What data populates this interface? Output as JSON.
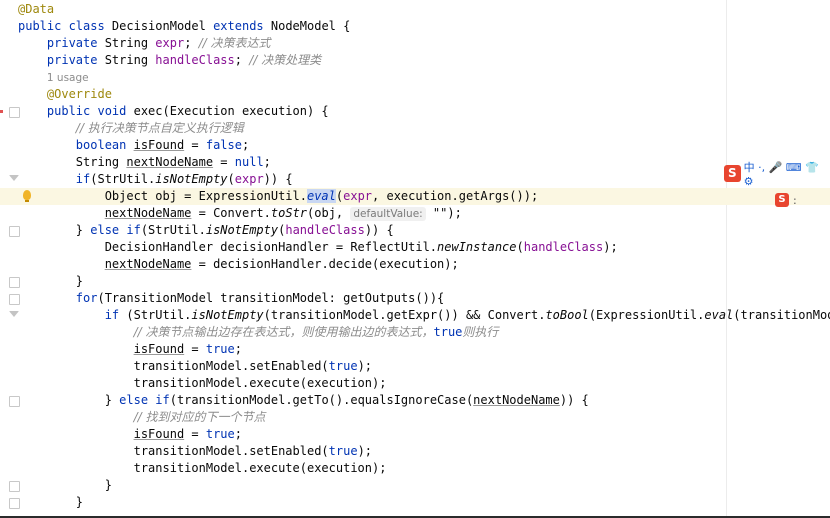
{
  "editor": {
    "lines": [
      {
        "tokens": [
          {
            "t": "@Data",
            "c": "ann"
          }
        ]
      },
      {
        "tokens": [
          {
            "t": "public class ",
            "c": "kw"
          },
          {
            "t": "DecisionModel "
          },
          {
            "t": "extends ",
            "c": "kw"
          },
          {
            "t": "NodeModel {"
          }
        ]
      },
      {
        "tokens": [
          {
            "t": "    private ",
            "c": "kw"
          },
          {
            "t": "String "
          },
          {
            "t": "expr",
            "c": "fld"
          },
          {
            "t": "; "
          },
          {
            "t": "// 决策表达式",
            "c": "cmt"
          }
        ]
      },
      {
        "tokens": [
          {
            "t": "    private ",
            "c": "kw"
          },
          {
            "t": "String "
          },
          {
            "t": "handleClass",
            "c": "fld"
          },
          {
            "t": "; "
          },
          {
            "t": "// 决策处理类",
            "c": "cmt"
          }
        ]
      },
      {
        "tokens": [
          {
            "t": "    "
          },
          {
            "t": "1 usage",
            "c": "usage"
          }
        ]
      },
      {
        "tokens": [
          {
            "t": "    @Override",
            "c": "ann"
          }
        ]
      },
      {
        "tokens": [
          {
            "t": "    public void ",
            "c": "kw"
          },
          {
            "t": "exec(Execution execution) {"
          }
        ]
      },
      {
        "tokens": [
          {
            "t": "        "
          },
          {
            "t": "// 执行决策节点自定义执行逻辑",
            "c": "cmt"
          }
        ]
      },
      {
        "tokens": [
          {
            "t": "        boolean ",
            "c": "kw"
          },
          {
            "t": "isFound",
            "c": "ul"
          },
          {
            "t": " = "
          },
          {
            "t": "false",
            "c": "kw"
          },
          {
            "t": ";"
          }
        ]
      },
      {
        "tokens": [
          {
            "t": "        String "
          },
          {
            "t": "nextNodeName",
            "c": "ul"
          },
          {
            "t": " = "
          },
          {
            "t": "null",
            "c": "kw"
          },
          {
            "t": ";"
          }
        ]
      },
      {
        "tokens": [
          {
            "t": "        if",
            "c": "kw"
          },
          {
            "t": "(StrUtil."
          },
          {
            "t": "isNotEmpty",
            "c": "it"
          },
          {
            "t": "("
          },
          {
            "t": "expr",
            "c": "fld"
          },
          {
            "t": ")) {"
          }
        ]
      },
      {
        "tokens": [
          {
            "t": "            Object obj = ExpressionUtil."
          },
          {
            "t": "eval",
            "c": "sel"
          },
          {
            "t": "("
          },
          {
            "t": "expr",
            "c": "fld"
          },
          {
            "t": ", execution.getArgs());"
          }
        ]
      },
      {
        "tokens": [
          {
            "t": "            "
          },
          {
            "t": "nextNodeName",
            "c": "ul"
          },
          {
            "t": " = Convert."
          },
          {
            "t": "toStr",
            "c": "it"
          },
          {
            "t": "(obj, "
          },
          {
            "t": "defaultValue:",
            "c": "hint"
          },
          {
            "t": " \"\");"
          }
        ]
      },
      {
        "tokens": [
          {
            "t": "        } "
          },
          {
            "t": "else if",
            "c": "kw"
          },
          {
            "t": "(StrUtil."
          },
          {
            "t": "isNotEmpty",
            "c": "it"
          },
          {
            "t": "("
          },
          {
            "t": "handleClass",
            "c": "fld"
          },
          {
            "t": ")) {"
          }
        ]
      },
      {
        "tokens": [
          {
            "t": "            DecisionHandler decisionHandler = ReflectUtil."
          },
          {
            "t": "newInstance",
            "c": "it"
          },
          {
            "t": "("
          },
          {
            "t": "handleClass",
            "c": "fld"
          },
          {
            "t": ");"
          }
        ]
      },
      {
        "tokens": [
          {
            "t": "            "
          },
          {
            "t": "nextNodeName",
            "c": "ul"
          },
          {
            "t": " = decisionHandler.decide(execution);"
          }
        ]
      },
      {
        "tokens": [
          {
            "t": "        }"
          }
        ]
      },
      {
        "tokens": [
          {
            "t": "        for",
            "c": "kw"
          },
          {
            "t": "(TransitionModel transitionModel: getOutputs()){"
          }
        ]
      },
      {
        "tokens": [
          {
            "t": "            if ",
            "c": "kw"
          },
          {
            "t": "(StrUtil."
          },
          {
            "t": "isNotEmpty",
            "c": "it"
          },
          {
            "t": "(transitionModel.getExpr()) && Convert."
          },
          {
            "t": "toBool",
            "c": "it"
          },
          {
            "t": "(ExpressionUtil."
          },
          {
            "t": "eval",
            "c": "it"
          },
          {
            "t": "(transitionModel.getExpr(), execution.g"
          }
        ]
      },
      {
        "tokens": [
          {
            "t": "                "
          },
          {
            "t": "// 决策节点输出边存在表达式，则使用输出边的表达式，",
            "c": "cmt"
          },
          {
            "t": "true",
            "c": "kw"
          },
          {
            "t": "则执行",
            "c": "cmt"
          }
        ]
      },
      {
        "tokens": [
          {
            "t": "                "
          },
          {
            "t": "isFound",
            "c": "ul"
          },
          {
            "t": " = "
          },
          {
            "t": "true",
            "c": "kw"
          },
          {
            "t": ";"
          }
        ]
      },
      {
        "tokens": [
          {
            "t": "                transitionModel.setEnabled("
          },
          {
            "t": "true",
            "c": "kw"
          },
          {
            "t": ");"
          }
        ]
      },
      {
        "tokens": [
          {
            "t": "                transitionModel.execute(execution);"
          }
        ]
      },
      {
        "tokens": [
          {
            "t": "            } "
          },
          {
            "t": "else if",
            "c": "kw"
          },
          {
            "t": "(transitionModel.getTo().equalsIgnoreCase("
          },
          {
            "t": "nextNodeName",
            "c": "ul"
          },
          {
            "t": ")) {"
          }
        ]
      },
      {
        "tokens": [
          {
            "t": "                "
          },
          {
            "t": "// 找到对应的下一个节点",
            "c": "cmt"
          }
        ]
      },
      {
        "tokens": [
          {
            "t": "                "
          },
          {
            "t": "isFound",
            "c": "ul"
          },
          {
            "t": " = "
          },
          {
            "t": "true",
            "c": "kw"
          },
          {
            "t": ";"
          }
        ]
      },
      {
        "tokens": [
          {
            "t": "                transitionModel.setEnabled("
          },
          {
            "t": "true",
            "c": "kw"
          },
          {
            "t": ");"
          }
        ]
      },
      {
        "tokens": [
          {
            "t": "                transitionModel.execute(execution);"
          }
        ]
      },
      {
        "tokens": [
          {
            "t": "            }"
          }
        ]
      },
      {
        "tokens": [
          {
            "t": "        }"
          }
        ]
      }
    ]
  },
  "ime": {
    "toolbar": "中 ·, 🎤 ⌨ 👕 ⚙",
    "small": ":"
  },
  "icons": {
    "ime_logo": "sogou-s-icon",
    "bulb": "lightbulb-icon"
  },
  "colors": {
    "keyword": "#0033b3",
    "annotation": "#9e880d",
    "field": "#871094",
    "comment": "#8c8c8c"
  }
}
